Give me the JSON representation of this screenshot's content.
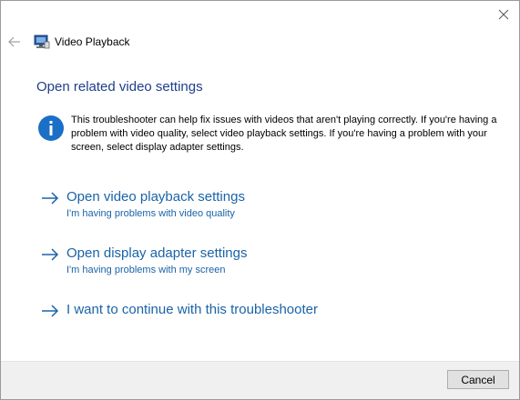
{
  "window": {
    "title": "Video Playback",
    "back_icon": "back-arrow-icon",
    "close_icon": "close-icon",
    "app_icon": "video-playback-icon"
  },
  "heading": "Open related video settings",
  "info": {
    "icon": "info-icon",
    "text": "This troubleshooter can help fix issues with videos that aren't playing correctly. If you're having a problem with video quality, select video playback settings. If you're having a problem with your screen, select display adapter settings."
  },
  "options": [
    {
      "label": "Open video playback settings",
      "sublabel": "I'm having problems with video quality",
      "icon": "arrow-right-icon"
    },
    {
      "label": "Open display adapter settings",
      "sublabel": "I'm having problems with my screen",
      "icon": "arrow-right-icon"
    },
    {
      "label": "I want to continue with this troubleshooter",
      "sublabel": "",
      "icon": "arrow-right-icon"
    }
  ],
  "footer": {
    "cancel_label": "Cancel"
  },
  "colors": {
    "heading": "#1e3f8a",
    "link": "#1a63a8",
    "info_icon": "#1c6fc7",
    "footer_bg": "#f0f0f0"
  }
}
